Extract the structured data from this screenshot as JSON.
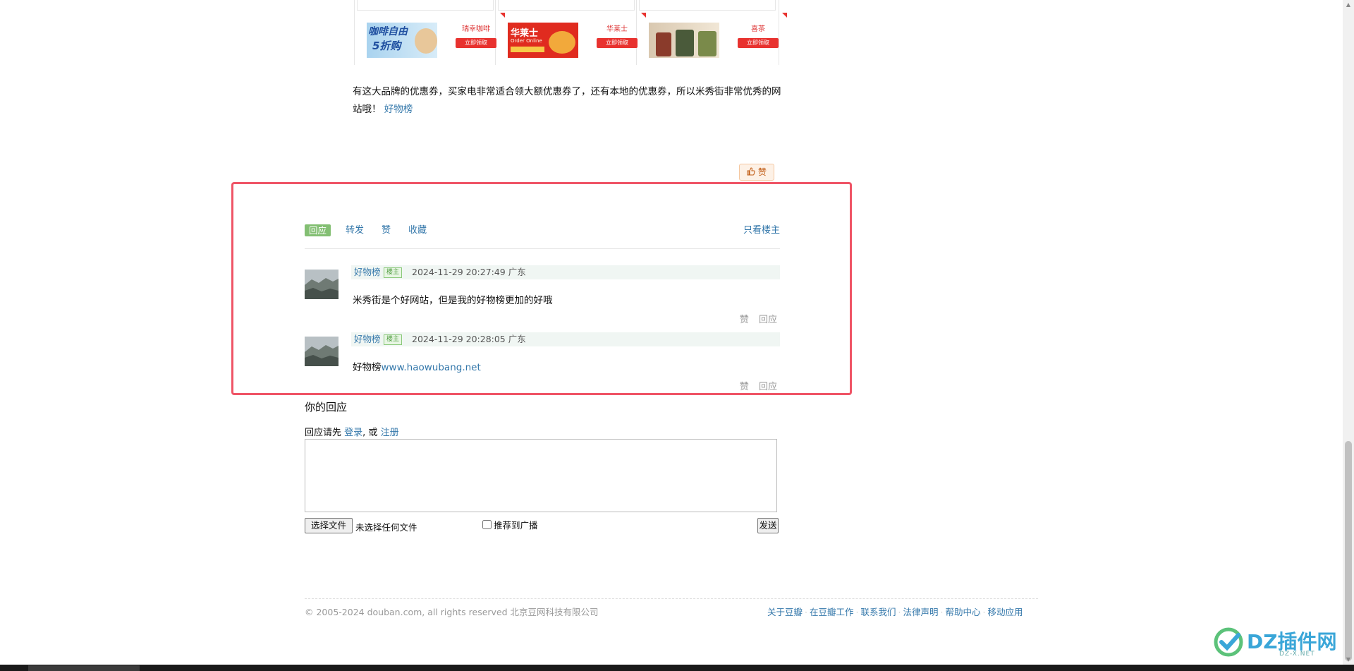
{
  "coupons": [
    {
      "img_line1": "咖啡自由",
      "img_line2": "5折购",
      "brand": "瑞幸咖啡",
      "button": "立即领取"
    },
    {
      "img_line1": "华莱士",
      "img_line2": "Order Online",
      "brand": "华莱士",
      "button": "立即领取"
    },
    {
      "img_line1": "",
      "img_line2": "",
      "brand": "喜茶",
      "button": "立即领取"
    }
  ],
  "post": {
    "text": "有这大品牌的优惠券，买家电非常适合领大额优惠券了，还有本地的优惠券，所以米秀街非常优秀的网站哦！",
    "link": "好物榜",
    "like_label": "赞"
  },
  "actions": {
    "reply": "回应",
    "forward": "转发",
    "like": "赞",
    "collect": "收藏",
    "only_op": "只看楼主"
  },
  "comments": [
    {
      "author": "好物榜",
      "badge": "楼主",
      "time": "2024-11-29 20:27:49 广东",
      "content": "米秀街是个好网站，但是我的好物榜更加的好哦",
      "link": "",
      "like": "赞",
      "reply": "回应"
    },
    {
      "author": "好物榜",
      "badge": "楼主",
      "time": "2024-11-29 20:28:05 广东",
      "content": "好物榜",
      "link": "www.haowubang.net",
      "like": "赞",
      "reply": "回应"
    }
  ],
  "reply_form": {
    "title": "你的回应",
    "hint_prefix": "回应请先",
    "login": "登录",
    "or": ", 或",
    "register": "注册",
    "file_button": "选择文件",
    "file_status": "未选择任何文件",
    "broadcast_label": "推荐到广播",
    "send": "发送"
  },
  "footer": {
    "copyright": "© 2005-2024 douban.com, all rights reserved 北京豆网科技有限公司",
    "links": [
      "关于豆瓣",
      "在豆瓣工作",
      "联系我们",
      "法律声明",
      "帮助中心",
      "移动应用"
    ]
  },
  "watermark": {
    "text": "DZ插件网",
    "sub": "DZ-X.NET"
  },
  "colors": {
    "link": "#3377aa",
    "highlight": "#ef5466",
    "reply_tab": "#83bf73",
    "coupon_red": "#e8322f"
  }
}
